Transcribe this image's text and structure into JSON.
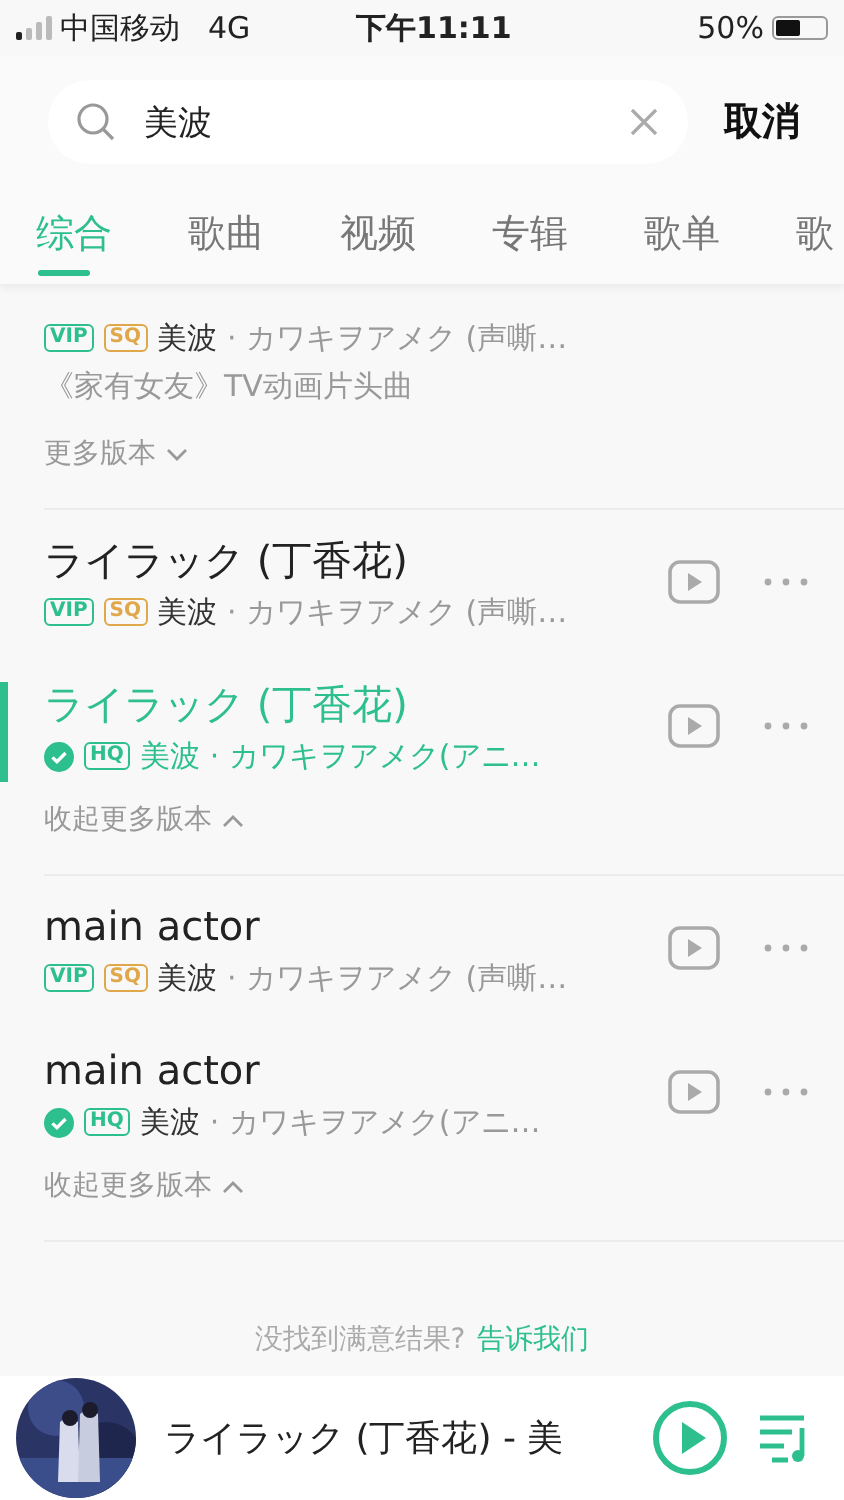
{
  "status_bar": {
    "carrier": "中国移动",
    "network": "4G",
    "time": "下午11:11",
    "battery": "50%"
  },
  "search": {
    "value": "美波",
    "cancel": "取消"
  },
  "tabs": [
    {
      "label": "综合",
      "selected": true
    },
    {
      "label": "歌曲",
      "selected": false
    },
    {
      "label": "视频",
      "selected": false
    },
    {
      "label": "专辑",
      "selected": false
    },
    {
      "label": "歌单",
      "selected": false
    },
    {
      "label": "歌",
      "selected": false
    }
  ],
  "groups": [
    {
      "songs": [
        {
          "badges": [
            {
              "kind": "vip",
              "label": "VIP"
            },
            {
              "kind": "sq",
              "label": "SQ"
            }
          ],
          "artist": "美波",
          "info": "· カワキヲアメク (声嘶…",
          "playing": false,
          "description": "《家有女友》TV动画片头曲"
        }
      ],
      "toggle": {
        "label": "更多版本",
        "expanded": false
      }
    },
    {
      "songs": [
        {
          "title": "ライラック (丁香花)",
          "badges": [
            {
              "kind": "vip",
              "label": "VIP"
            },
            {
              "kind": "sq",
              "label": "SQ"
            }
          ],
          "artist": "美波",
          "info": "· カワキヲアメク (声嘶…",
          "playing": false
        },
        {
          "title": "ライラック (丁香花)",
          "badges": [
            {
              "kind": "check"
            },
            {
              "kind": "hq",
              "label": "HQ"
            }
          ],
          "artist": "美波",
          "info": "· カワキヲアメク(アニ…",
          "playing": true
        }
      ],
      "toggle": {
        "label": "收起更多版本",
        "expanded": true
      }
    },
    {
      "songs": [
        {
          "title": "main actor",
          "badges": [
            {
              "kind": "vip",
              "label": "VIP"
            },
            {
              "kind": "sq",
              "label": "SQ"
            }
          ],
          "artist": "美波",
          "info": "· カワキヲアメク (声嘶…",
          "playing": false
        },
        {
          "title": "main actor",
          "badges": [
            {
              "kind": "check"
            },
            {
              "kind": "hq",
              "label": "HQ"
            }
          ],
          "artist": "美波",
          "info": "· カワキヲアメク(アニ…",
          "playing": false
        }
      ],
      "toggle": {
        "label": "收起更多版本",
        "expanded": true
      }
    }
  ],
  "feedback": {
    "text": "没找到满意结果?",
    "link": "告诉我们"
  },
  "player": {
    "kind": "picture",
    "title": "ライラック (丁香花) - 美"
  }
}
